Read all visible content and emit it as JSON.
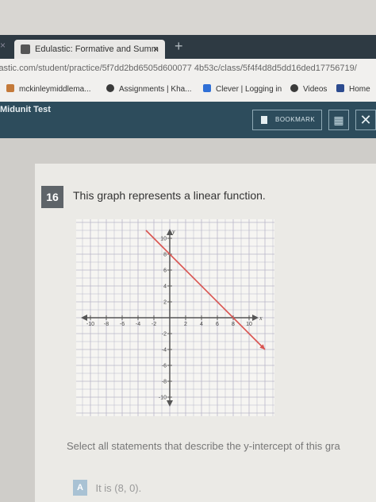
{
  "browser": {
    "prev_tab_glyph": "×",
    "tab_title": "Edulastic: Formative and Summ",
    "tab_close": "×",
    "new_tab_glyph": "+",
    "url": "lastic.com/student/practice/5f7dd2bd6505d600077 4b53c/class/5f4f4d8d5dd16ded17756719/",
    "bookmarks": [
      {
        "label": "mckinleymiddlema...",
        "icon": "bookmark-favicon",
        "color": "#c47a3a"
      },
      {
        "label": "Assignments | Kha...",
        "icon": "khan-academy-icon",
        "color": "#3a3a3a"
      },
      {
        "label": "Clever | Logging in",
        "icon": "clever-icon",
        "color": "#2f6fd6"
      },
      {
        "label": "Videos",
        "icon": "videos-icon",
        "color": "#3a3a3a"
      },
      {
        "label": "Home",
        "icon": "r-logo-icon",
        "color": "#2c4b8f"
      }
    ]
  },
  "app": {
    "title": "Midunit Test",
    "bookmark_label": "BOOKMARK",
    "grid_glyph": "▦",
    "close_glyph": "✕"
  },
  "question": {
    "number": "16",
    "text": "This graph represents a linear function.",
    "prompt": "Select all statements that describe the y-intercept of this gra",
    "options": [
      {
        "letter": "A",
        "text": "It is (8, 0)."
      }
    ]
  },
  "chart_data": {
    "type": "line",
    "xlim": [
      -10,
      10
    ],
    "ylim": [
      -10,
      10
    ],
    "grid": true,
    "x_ticks": [
      "-10",
      "-8",
      "-6",
      "-4",
      "-2",
      "2",
      "4",
      "6",
      "8",
      "10"
    ],
    "y_ticks": [
      "10",
      "8",
      "6",
      "4",
      "2",
      "-2",
      "-4",
      "-6",
      "-8",
      "-10"
    ],
    "xlabel": "x",
    "ylabel": "y",
    "line_color": "#d9534f",
    "series": [
      {
        "x": [
          -3,
          12
        ],
        "y": [
          11,
          -4
        ]
      }
    ]
  }
}
